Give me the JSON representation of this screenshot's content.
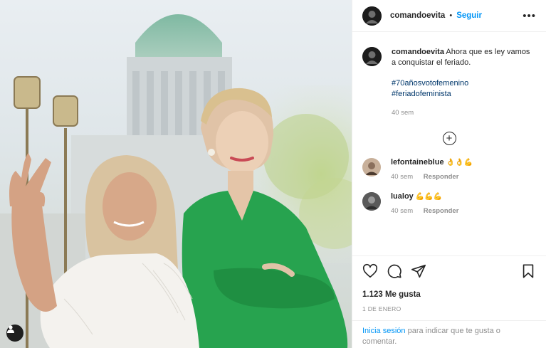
{
  "post": {
    "username": "comandoevita",
    "follow_label": "Seguir",
    "separator": "•",
    "more_label": "•••",
    "caption": {
      "username": "comandoevita",
      "text": "Ahora que es ley vamos a conquistar el feriado.",
      "hashtags": [
        "#70añosvotofemenino",
        "#feriadofeminista"
      ],
      "time": "40 sem"
    },
    "load_more_icon": "plus-circle-icon",
    "comments": [
      {
        "username": "lefontaineblue",
        "text": "👌👌💪",
        "time": "40 sem",
        "reply_label": "Responder"
      },
      {
        "username": "lualoy",
        "text": "💪💪💪",
        "time": "40 sem",
        "reply_label": "Responder"
      }
    ],
    "likes": "1.123 Me gusta",
    "date": "1 DE ENERO",
    "login": {
      "link": "Inicia sesión",
      "text": "para indicar que te gusta o comentar."
    }
  },
  "colors": {
    "accent": "#0095f6",
    "hashtag": "#00376b",
    "muted": "#8e8e8e",
    "text": "#262626"
  }
}
